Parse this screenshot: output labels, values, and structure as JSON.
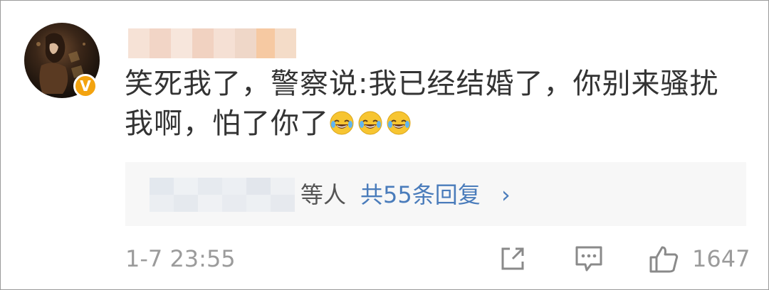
{
  "comment": {
    "line1": "笑死我了，警察说:我已经结婚了，你别来骚扰",
    "line2": "我啊，怕了你了",
    "emojis": [
      "laugh-cry-emoji",
      "laugh-cry-emoji",
      "laugh-cry-emoji"
    ]
  },
  "user": {
    "verified_badge": "V"
  },
  "replies": {
    "suffix": "等人",
    "count_text": "共55条回复",
    "chevron": "›"
  },
  "footer": {
    "timestamp": "1-7 23:55",
    "like_count": "1647",
    "icons": [
      "share-icon",
      "comment-icon",
      "like-icon"
    ]
  },
  "colors": {
    "link": "#4a7cbb",
    "text": "#333333",
    "muted": "#9b9b9b",
    "badge": "#f3a30f",
    "reply_bg": "#f7f7f7"
  }
}
